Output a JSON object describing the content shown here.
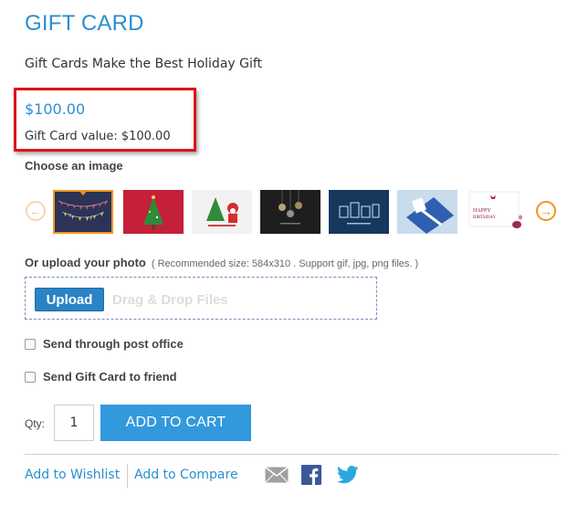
{
  "product": {
    "title": "GIFT CARD",
    "subtitle": "Gift Cards Make the Best Holiday Gift",
    "price": "$100.00",
    "gift_card_value": "Gift Card value: $100.00"
  },
  "image_chooser": {
    "label": "Choose an image",
    "selected_index": 0,
    "thumbnails": [
      {
        "theme": "dark navy card with colorful bunting",
        "bg": "#2c3356"
      },
      {
        "theme": "red card with christmas tree",
        "bg": "#c4203a"
      },
      {
        "theme": "white card with santa and tree",
        "bg": "#f2f2f2"
      },
      {
        "theme": "dark card with hanging ornaments",
        "bg": "#1e1e1e"
      },
      {
        "theme": "blue card with holiday gifts",
        "bg": "#16385e"
      },
      {
        "theme": "light blue gift box with ribbon",
        "bg": "#c9dcee"
      },
      {
        "theme": "white happy birthday card",
        "bg": "#ffffff",
        "text": "HAPPY BIRTHDAY"
      }
    ]
  },
  "upload": {
    "label": "Or upload your photo",
    "hint": "( Recommended size: 584x310 .   Support gif, jpg, png files. )",
    "button_label": "Upload",
    "drop_text": "Drag & Drop Files"
  },
  "options": {
    "post_office_label": "Send through post office",
    "friend_label": "Send Gift Card to friend"
  },
  "cart": {
    "qty_label": "Qty:",
    "qty_value": "1",
    "add_to_cart_label": "ADD TO CART"
  },
  "links": {
    "wishlist": "Add to Wishlist",
    "compare": "Add to Compare"
  },
  "colors": {
    "accent": "#2a8fd0",
    "button": "#3399dd",
    "highlight_border": "#e0101a",
    "carousel_orange": "#f29422"
  },
  "icons": [
    "arrow-left-icon",
    "arrow-right-icon",
    "email-icon",
    "facebook-icon",
    "twitter-icon"
  ]
}
